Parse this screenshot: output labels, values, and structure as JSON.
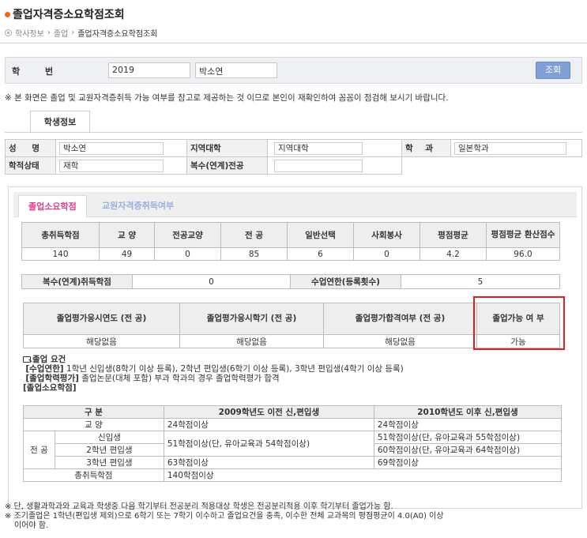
{
  "page": {
    "title": "졸업자격증소요학점조회",
    "breadcrumb": [
      "학사정보",
      "졸업",
      "졸업자격증소요학점조회"
    ]
  },
  "search": {
    "label": "학 번",
    "student_id": "2019",
    "student_name": "박소연",
    "button": "조회"
  },
  "notice": "※ 본 화면은 졸업 및 교원자격증취득 가능 여부를 참고로 제공하는 것 이므로 본인이 재확인하여 꼼꼼이 점검해 보시기 바랍니다.",
  "student_tab": "학생정보",
  "student_info": {
    "name_label": "성 명",
    "name": "박소연",
    "region_label": "지역대학",
    "region": "지역대학",
    "dept_label": "학 과",
    "dept": "일본학과",
    "status_label": "학적상태",
    "status": "재학",
    "double_major_label": "복수(연계)전공",
    "double_major": ""
  },
  "panel_tabs": {
    "active": "졸업소요학점",
    "inactive": "교원자격증취득여부"
  },
  "credits": {
    "headers": [
      "총취득학점",
      "교 양",
      "전공교양",
      "전 공",
      "일반선택",
      "사회봉사",
      "평점평균",
      "평점평균 환산점수"
    ],
    "values": [
      "140",
      "49",
      "0",
      "85",
      "6",
      "0",
      "4.2",
      "96.0"
    ]
  },
  "dual": {
    "double_label": "복수(연계)취득학점",
    "double_value": "0",
    "years_label": "수업연한(등록횟수)",
    "years_value": "5"
  },
  "graduation_eval": {
    "headers": [
      "졸업평가응시연도 (전 공)",
      "졸업평가응시학기 (전 공)",
      "졸업평가합격여부 (전 공)",
      "졸업가능 여 부"
    ],
    "values": [
      "해당없음",
      "해당없음",
      "해당없음",
      "가능"
    ]
  },
  "requirements": {
    "heading": "졸업 요건",
    "line1_key": "[수업연한]",
    "line1_text": "1학년 신입생(8학기 이상 등록), 2학년 편입생(6학기 이상 등록), 3학년 편입생(4학기 이상 등록)",
    "line2_key": "[졸업학력평가]",
    "line2_text": "졸업논문(대체 포함) 부과 학과의 경우 졸업학력평가 합격",
    "line3": "[졸업소요학점]"
  },
  "req_table": {
    "col_header": "구 분",
    "col_before": "2009학년도 이전 신,편입생",
    "col_after": "2010학년도 이후 신,편입생",
    "rows": {
      "liberal": {
        "label": "교 양",
        "before": "24학점이상",
        "after": "24학점이상"
      },
      "major_label": "전 공",
      "freshman": {
        "label": "신입생",
        "after": "51학점이상(단, 유아교육과 55학점이상)"
      },
      "sophomore": {
        "label": "2학년 편입생",
        "after": "60학점이상(단, 유아교육과 64학점이상)"
      },
      "major_before": "51학점이상(단, 유아교육과 54학점이상)",
      "junior": {
        "label": "3학년 편입생",
        "before": "63학점이상",
        "after": "69학점이상"
      },
      "total": {
        "label": "총취득학점",
        "value": "140학점이상"
      }
    }
  },
  "footnotes": [
    "※ 단, 생활과학과와 교육과 학생중 다음 학기부터 전공분리 적용대상 학생은 전공분리적용 이후 학기부터 졸업가능 함.",
    "※ 조기졸업은 1학년(편입생 제외)으로 6학기 또는 7학기 이수하고 졸업요건을 충족, 이수한 전체 교과목의 평점평균이 4.0(A0) 이상",
    "이어야 함."
  ]
}
